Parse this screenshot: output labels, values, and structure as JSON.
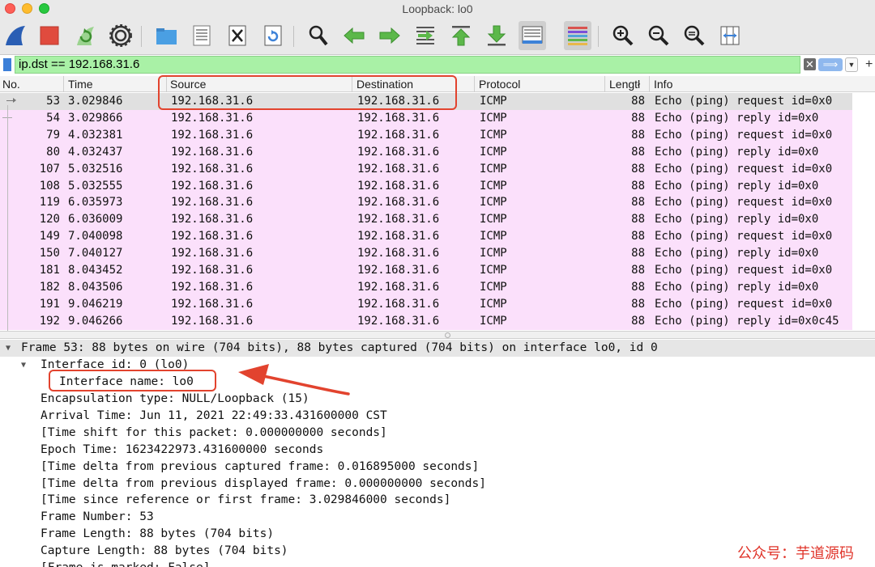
{
  "window": {
    "title": "Loopback: lo0"
  },
  "toolbar": {
    "buttons": [
      {
        "name": "start-capture-icon",
        "color": "#2a5eb4"
      },
      {
        "name": "stop-capture-icon",
        "color": "#e04b3e"
      },
      {
        "name": "restart-capture-icon",
        "color": "#59b24c"
      },
      {
        "name": "capture-options-icon",
        "color": "#555555"
      },
      {
        "name": "open-file-icon",
        "color": "#3d93d8"
      },
      {
        "name": "save-file-icon",
        "color": "#777777"
      },
      {
        "name": "close-file-icon",
        "color": "#555555"
      },
      {
        "name": "reload-file-icon",
        "color": "#3d82d8"
      },
      {
        "name": "find-packet-icon",
        "color": "#333333"
      },
      {
        "name": "go-back-icon",
        "color": "#47a83a"
      },
      {
        "name": "go-forward-icon",
        "color": "#47a83a"
      },
      {
        "name": "go-to-packet-icon",
        "color": "#47a83a"
      },
      {
        "name": "go-first-packet-icon",
        "color": "#47a83a"
      },
      {
        "name": "go-last-packet-icon",
        "color": "#47a83a"
      },
      {
        "name": "autoscroll-icon",
        "color": "#3d82d8"
      },
      {
        "name": "colorize-icon",
        "color": "#d9534f"
      },
      {
        "name": "zoom-in-icon",
        "color": "#333333"
      },
      {
        "name": "zoom-out-icon",
        "color": "#333333"
      },
      {
        "name": "normal-size-icon",
        "color": "#333333"
      },
      {
        "name": "resize-columns-icon",
        "color": "#3d82d8"
      }
    ]
  },
  "filter": {
    "value": "ip.dst == 192.168.31.6",
    "clear_glyph": "✕",
    "apply_glyph": "⟹",
    "dropdown_glyph": "▼",
    "add_glyph": "+",
    "color": "#a9f1a6"
  },
  "packet_list": {
    "columns": [
      "No.",
      "Time",
      "Source",
      "Destination",
      "Protocol",
      "Lengtł",
      "Info"
    ],
    "row_color": "#fbe0fb",
    "rows": [
      {
        "no": "53",
        "time": "3.029846",
        "src": "192.168.31.6",
        "dst": "192.168.31.6",
        "proto": "ICMP",
        "len": "88",
        "info": "Echo (ping) request  id=0x0"
      },
      {
        "no": "54",
        "time": "3.029866",
        "src": "192.168.31.6",
        "dst": "192.168.31.6",
        "proto": "ICMP",
        "len": "88",
        "info": "Echo (ping) reply    id=0x0"
      },
      {
        "no": "79",
        "time": "4.032381",
        "src": "192.168.31.6",
        "dst": "192.168.31.6",
        "proto": "ICMP",
        "len": "88",
        "info": "Echo (ping) request  id=0x0"
      },
      {
        "no": "80",
        "time": "4.032437",
        "src": "192.168.31.6",
        "dst": "192.168.31.6",
        "proto": "ICMP",
        "len": "88",
        "info": "Echo (ping) reply    id=0x0"
      },
      {
        "no": "107",
        "time": "5.032516",
        "src": "192.168.31.6",
        "dst": "192.168.31.6",
        "proto": "ICMP",
        "len": "88",
        "info": "Echo (ping) request  id=0x0"
      },
      {
        "no": "108",
        "time": "5.032555",
        "src": "192.168.31.6",
        "dst": "192.168.31.6",
        "proto": "ICMP",
        "len": "88",
        "info": "Echo (ping) reply    id=0x0"
      },
      {
        "no": "119",
        "time": "6.035973",
        "src": "192.168.31.6",
        "dst": "192.168.31.6",
        "proto": "ICMP",
        "len": "88",
        "info": "Echo (ping) request  id=0x0"
      },
      {
        "no": "120",
        "time": "6.036009",
        "src": "192.168.31.6",
        "dst": "192.168.31.6",
        "proto": "ICMP",
        "len": "88",
        "info": "Echo (ping) reply    id=0x0"
      },
      {
        "no": "149",
        "time": "7.040098",
        "src": "192.168.31.6",
        "dst": "192.168.31.6",
        "proto": "ICMP",
        "len": "88",
        "info": "Echo (ping) request  id=0x0"
      },
      {
        "no": "150",
        "time": "7.040127",
        "src": "192.168.31.6",
        "dst": "192.168.31.6",
        "proto": "ICMP",
        "len": "88",
        "info": "Echo (ping) reply    id=0x0"
      },
      {
        "no": "181",
        "time": "8.043452",
        "src": "192.168.31.6",
        "dst": "192.168.31.6",
        "proto": "ICMP",
        "len": "88",
        "info": "Echo (ping) request  id=0x0"
      },
      {
        "no": "182",
        "time": "8.043506",
        "src": "192.168.31.6",
        "dst": "192.168.31.6",
        "proto": "ICMP",
        "len": "88",
        "info": "Echo (ping) reply    id=0x0"
      },
      {
        "no": "191",
        "time": "9.046219",
        "src": "192.168.31.6",
        "dst": "192.168.31.6",
        "proto": "ICMP",
        "len": "88",
        "info": "Echo (ping) request  id=0x0"
      },
      {
        "no": "192",
        "time": "9.046266",
        "src": "192.168.31.6",
        "dst": "192.168.31.6",
        "proto": "ICMP",
        "len": "88",
        "info": "Echo (ping) reply    id=0x0c45"
      }
    ]
  },
  "details": {
    "frame_summary": "Frame 53: 88 bytes on wire (704 bits), 88 bytes captured (704 bits) on interface lo0, id 0",
    "interface_id": "Interface id: 0 (lo0)",
    "interface_name": "Interface name: lo0",
    "lines": [
      "Encapsulation type: NULL/Loopback (15)",
      "Arrival Time: Jun 11, 2021 22:49:33.431600000 CST",
      "[Time shift for this packet: 0.000000000 seconds]",
      "Epoch Time: 1623422973.431600000 seconds",
      "[Time delta from previous captured frame: 0.016895000 seconds]",
      "[Time delta from previous displayed frame: 0.000000000 seconds]",
      "[Time since reference or first frame: 3.029846000 seconds]",
      "Frame Number: 53",
      "Frame Length: 88 bytes (704 bits)",
      "Capture Length: 88 bytes (704 bits)",
      "[Frame is marked: False]"
    ]
  },
  "annotation": {
    "color": "#e2432e"
  },
  "watermark": "公众号：芋道源码"
}
